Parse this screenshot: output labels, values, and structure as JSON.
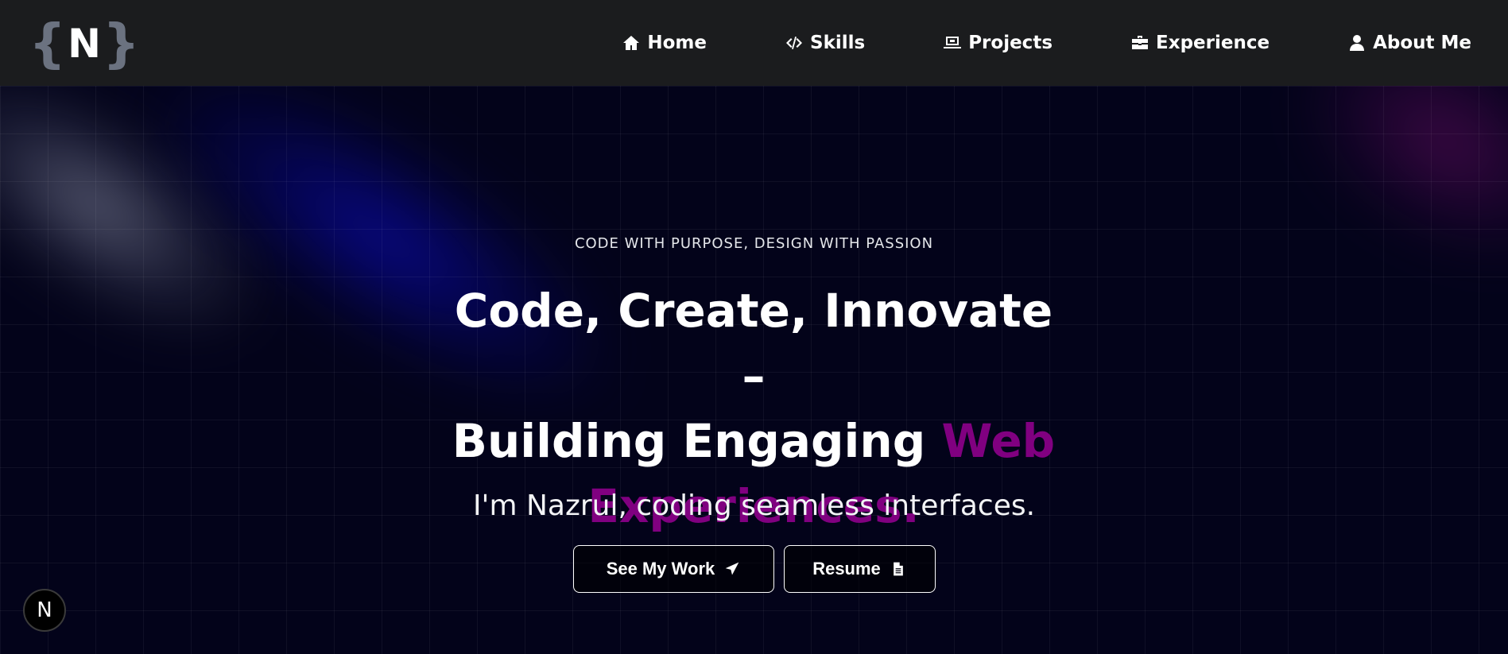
{
  "logo": {
    "open_brace": "{",
    "letter": "N",
    "close_brace": "}"
  },
  "nav": {
    "items": [
      {
        "label": "Home",
        "icon": "home-icon"
      },
      {
        "label": "Skills",
        "icon": "code-icon"
      },
      {
        "label": "Projects",
        "icon": "laptop-icon"
      },
      {
        "label": "Experience",
        "icon": "briefcase-icon"
      },
      {
        "label": "About Me",
        "icon": "user-icon"
      }
    ]
  },
  "hero": {
    "tagline": "CODE WITH PURPOSE, DESIGN WITH PASSION",
    "headline_line1": "Code, Create, Innovate –",
    "headline_line2": "Building Engaging ",
    "headline_accent": "Web Experiences.",
    "subtitle": "I'm Nazrul, coding seamless interfaces.",
    "buttons": {
      "primary": {
        "label": "See My Work",
        "icon": "paper-plane-icon"
      },
      "secondary": {
        "label": "Resume",
        "icon": "file-icon"
      }
    }
  },
  "badge": {
    "letter": "N"
  },
  "colors": {
    "navbar_bg": "#1b1c1e",
    "page_bg": "#03031a",
    "accent": "#800080",
    "logo_brace": "#6b7280"
  }
}
